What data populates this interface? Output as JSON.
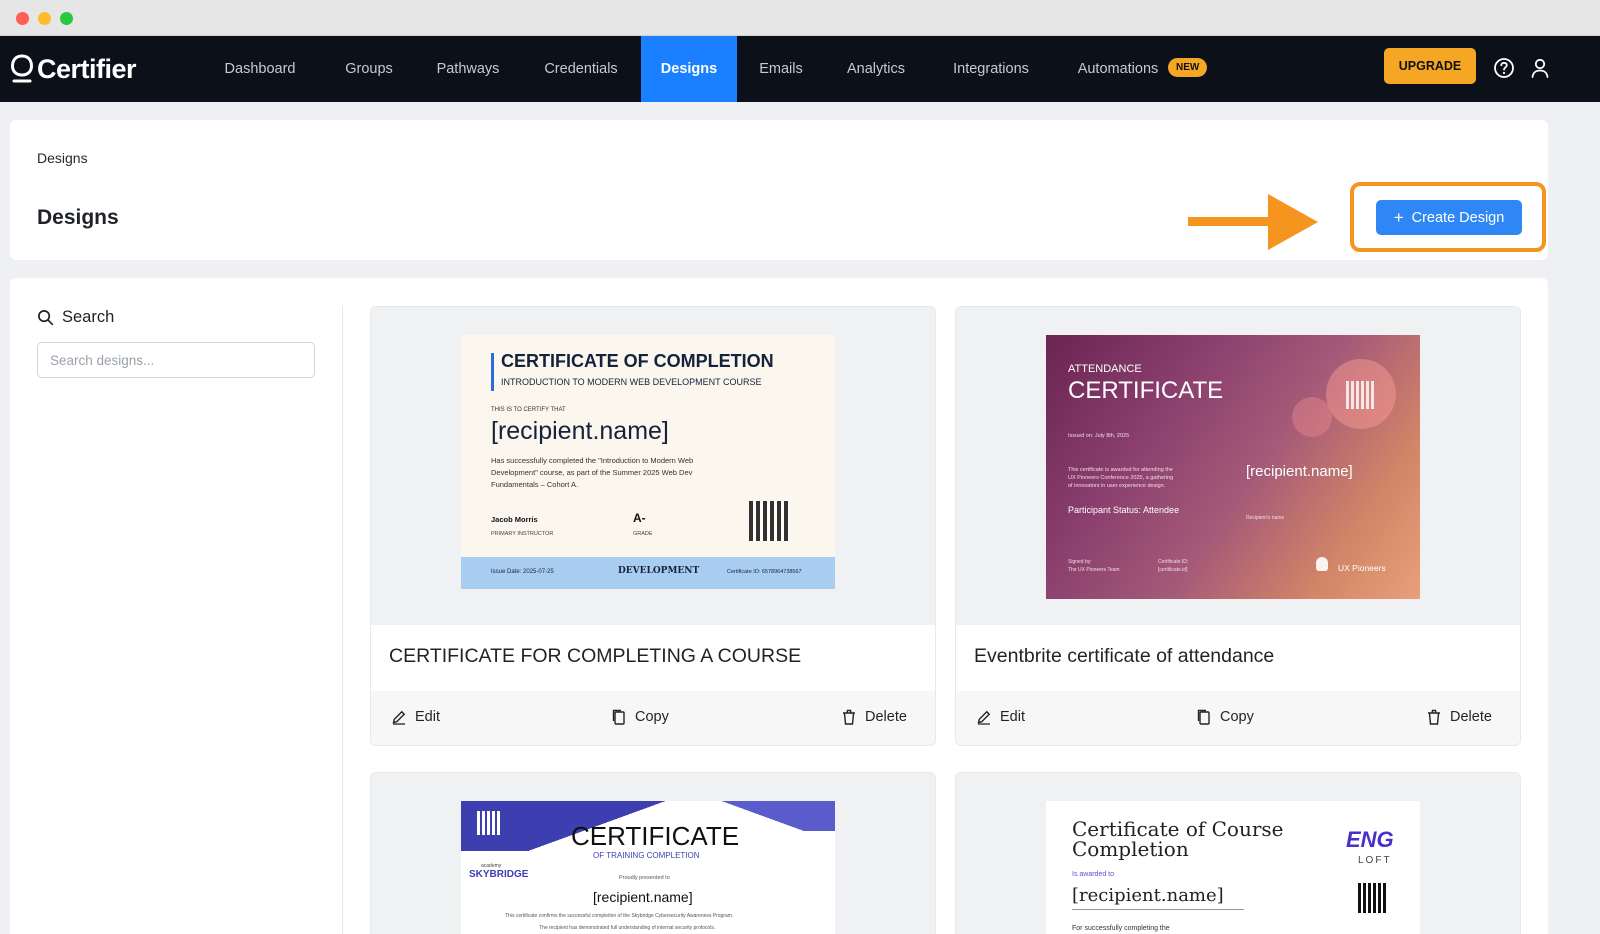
{
  "app": {
    "brand": "Certifier"
  },
  "nav": {
    "items": [
      {
        "label": "Dashboard"
      },
      {
        "label": "Groups"
      },
      {
        "label": "Pathways"
      },
      {
        "label": "Credentials"
      },
      {
        "label": "Designs",
        "active": true
      },
      {
        "label": "Emails"
      },
      {
        "label": "Analytics"
      },
      {
        "label": "Integrations"
      },
      {
        "label": "Automations"
      }
    ],
    "badge": "NEW",
    "upgrade_label": "UPGRADE",
    "icons": [
      "help-circle-icon",
      "user-icon"
    ]
  },
  "header": {
    "breadcrumb": "Designs",
    "title": "Designs",
    "create_label": "Create Design",
    "create_icon": "plus-icon"
  },
  "sidebar": {
    "search_label": "Search",
    "search_placeholder": "Search designs..."
  },
  "actions": {
    "edit": "Edit",
    "copy": "Copy",
    "delete": "Delete"
  },
  "designs": [
    {
      "title": "CERTIFICATE FOR COMPLETING A COURSE",
      "preview": {
        "heading": "CERTIFICATE OF COMPLETION",
        "subheading": "INTRODUCTION TO MODERN WEB DEVELOPMENT COURSE",
        "certify": "THIS IS TO CERTIFY THAT",
        "recipient": "[recipient.name]",
        "body1": "Has successfully completed the \"Introduction to Modern Web",
        "body2": "Development\" course, as part of the Summer 2025 Web Dev",
        "body3": "Fundamentals – Cohort A.",
        "instructor": "Jacob Morris",
        "instructor_role": "PRIMARY INSTRUCTOR",
        "grade": "A-",
        "grade_label": "GRADE",
        "issue": "Issue Date: 2025-07-25",
        "seal": "DEVELOPMENT",
        "cert_id": "Certificate ID: 6578964738567"
      }
    },
    {
      "title": "Eventbrite certificate of attendance",
      "preview": {
        "kicker": "ATTENDANCE",
        "heading": "CERTIFICATE",
        "issued": "Issued on:   July 8th, 2025",
        "body1": "This certificate is awarded for attending the",
        "body2": "UX Pioneers Conference 2025, a gathering",
        "body3": "of innovators in user experience design.",
        "recipient": "[recipient.name]",
        "recipient_sub": "Recipient's name",
        "status": "Participant Status: Attendee",
        "signed": "Signed by:",
        "signed2": "The UX Pioneers Team",
        "cert_id": "Certificate ID:",
        "cert_id2": "[certificate.id]",
        "org": "UX Pioneers"
      }
    },
    {
      "title": "",
      "preview": {
        "heading": "CERTIFICATE",
        "subheading": "OF TRAINING COMPLETION",
        "org_small": "academy",
        "org": "SKYBRIDGE",
        "presented": "Proudly presented to",
        "recipient": "[recipient.name]",
        "body1": "This certificate confirms the successful completion of the Skybridge Cybersecurity Awareness Program.",
        "body2": "The recipient has demonstrated full understanding of internal security protocols."
      }
    },
    {
      "title": "",
      "preview": {
        "heading1": "Certificate of Course",
        "heading2": "Completion",
        "awarded": "Is awarded to",
        "recipient": "[recipient.name]",
        "body1": "For successfully completing the",
        "logo1": "ENG",
        "logo2": "LOFT"
      }
    }
  ]
}
